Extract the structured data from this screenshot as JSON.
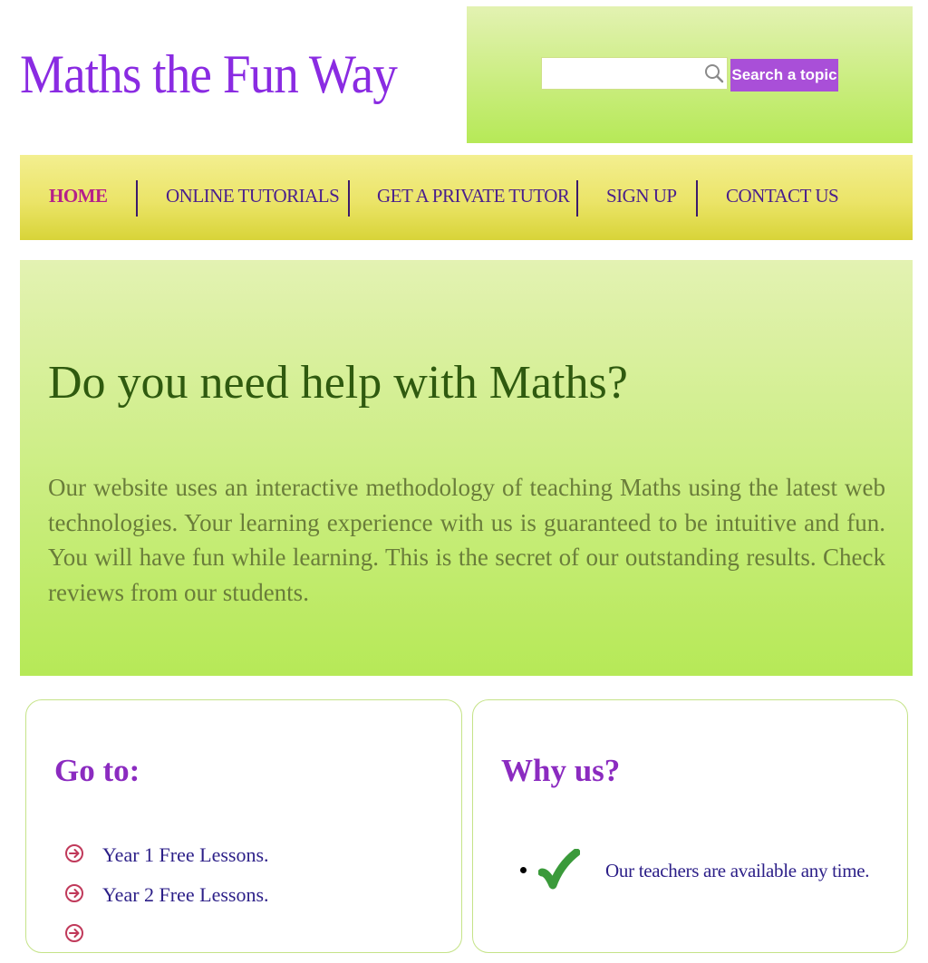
{
  "header": {
    "site_title": "Maths the Fun Way"
  },
  "search": {
    "input_value": "",
    "placeholder": "",
    "button_label": "Search a topic",
    "icon": "search-icon"
  },
  "nav": {
    "items": [
      {
        "label": "HOME",
        "active": true
      },
      {
        "label": "ONLINE TUTORIALS",
        "active": false
      },
      {
        "label": "GET A PRIVATE TUTOR",
        "active": false
      },
      {
        "label": "SIGN UP",
        "active": false
      },
      {
        "label": "CONTACT US",
        "active": false
      }
    ]
  },
  "hero": {
    "heading": "Do you need help with Maths?",
    "text": "Our website uses an interactive methodology of teaching Maths using the latest web technologies. Your learning experience with us is guaranteed to be intuitive and fun. You will have fun while learning. This is the secret of our outstanding results. Check reviews from our students."
  },
  "goto": {
    "title": "Go to:",
    "items": [
      {
        "label": "Year 1 Free Lessons.",
        "icon": "arrow-circle-icon"
      },
      {
        "label": "Year 2 Free Lessons.",
        "icon": "arrow-circle-icon"
      },
      {
        "label": "",
        "icon": "arrow-circle-icon"
      }
    ]
  },
  "why": {
    "title": "Why us?",
    "items": [
      {
        "text": "Our teachers are available any time.",
        "icon": "checkmark-icon"
      }
    ]
  },
  "colors": {
    "title_purple": "#8a2be2",
    "search_button": "#a94fd8",
    "panel_green_top": "#e3f2b2",
    "panel_green_bottom": "#b6e957",
    "nav_yellow": "#ebe468",
    "nav_active": "#b51f8a",
    "heading_green": "#2f5a0f",
    "card_title": "#8b2bc0",
    "checkmark": "#3a9a3a",
    "arrow": "#c0395a"
  }
}
